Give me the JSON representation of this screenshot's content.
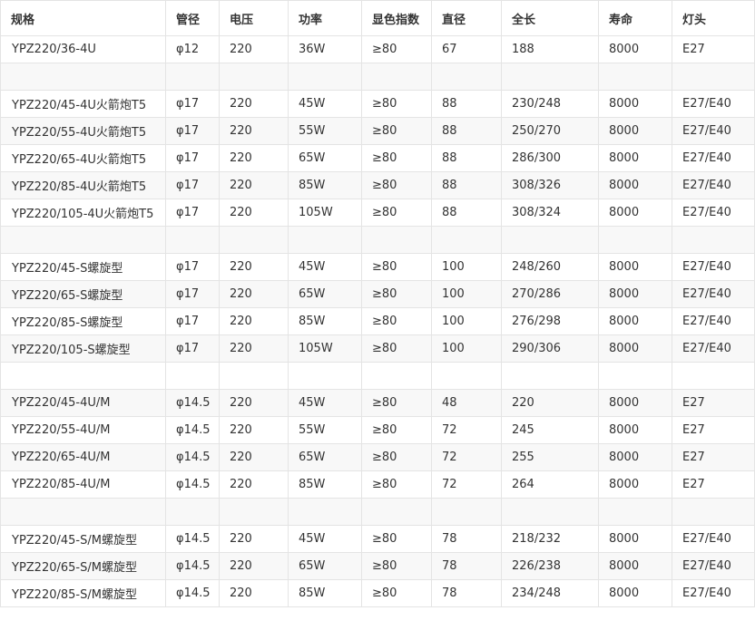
{
  "columns": [
    "规格",
    "管径",
    "电压",
    "功率",
    "显色指数",
    "直径",
    "全长",
    "寿命",
    "灯头"
  ],
  "rows": [
    [
      "YPZ220/36-4U",
      "φ12",
      "220",
      "36W",
      "≥80",
      "67",
      "188",
      "8000",
      "E27"
    ],
    [
      "",
      "",
      "",
      "",
      "",
      "",
      "",
      "",
      ""
    ],
    [
      "YPZ220/45-4U火箭炮T5",
      "φ17",
      "220",
      "45W",
      "≥80",
      "88",
      "230/248",
      "8000",
      "E27/E40"
    ],
    [
      "YPZ220/55-4U火箭炮T5",
      "φ17",
      "220",
      "55W",
      "≥80",
      "88",
      "250/270",
      "8000",
      "E27/E40"
    ],
    [
      "YPZ220/65-4U火箭炮T5",
      "φ17",
      "220",
      "65W",
      "≥80",
      "88",
      "286/300",
      "8000",
      "E27/E40"
    ],
    [
      "YPZ220/85-4U火箭炮T5",
      "φ17",
      "220",
      "85W",
      "≥80",
      "88",
      "308/326",
      "8000",
      "E27/E40"
    ],
    [
      "YPZ220/105-4U火箭炮T5",
      "φ17",
      "220",
      "105W",
      "≥80",
      "88",
      "308/324",
      "8000",
      "E27/E40"
    ],
    [
      "",
      "",
      "",
      "",
      "",
      "",
      "",
      "",
      ""
    ],
    [
      "YPZ220/45-S螺旋型",
      "φ17",
      "220",
      "45W",
      "≥80",
      "100",
      "248/260",
      "8000",
      "E27/E40"
    ],
    [
      "YPZ220/65-S螺旋型",
      "φ17",
      "220",
      "65W",
      "≥80",
      "100",
      "270/286",
      "8000",
      "E27/E40"
    ],
    [
      "YPZ220/85-S螺旋型",
      "φ17",
      "220",
      "85W",
      "≥80",
      "100",
      "276/298",
      "8000",
      "E27/E40"
    ],
    [
      "YPZ220/105-S螺旋型",
      "φ17",
      "220",
      "105W",
      "≥80",
      "100",
      "290/306",
      "8000",
      "E27/E40"
    ],
    [
      "",
      "",
      "",
      "",
      "",
      "",
      "",
      "",
      ""
    ],
    [
      "YPZ220/45-4U/M",
      "φ14.5",
      "220",
      "45W",
      "≥80",
      "48",
      "220",
      "8000",
      "E27"
    ],
    [
      "YPZ220/55-4U/M",
      "φ14.5",
      "220",
      "55W",
      "≥80",
      "72",
      "245",
      "8000",
      "E27"
    ],
    [
      "YPZ220/65-4U/M",
      "φ14.5",
      "220",
      "65W",
      "≥80",
      "72",
      "255",
      "8000",
      "E27"
    ],
    [
      "YPZ220/85-4U/M",
      "φ14.5",
      "220",
      "85W",
      "≥80",
      "72",
      "264",
      "8000",
      "E27"
    ],
    [
      "",
      "",
      "",
      "",
      "",
      "",
      "",
      "",
      ""
    ],
    [
      "YPZ220/45-S/M螺旋型",
      "φ14.5",
      "220",
      "45W",
      "≥80",
      "78",
      "218/232",
      "8000",
      "E27/E40"
    ],
    [
      "YPZ220/65-S/M螺旋型",
      "φ14.5",
      "220",
      "65W",
      "≥80",
      "78",
      "226/238",
      "8000",
      "E27/E40"
    ],
    [
      "YPZ220/85-S/M螺旋型",
      "φ14.5",
      "220",
      "85W",
      "≥80",
      "78",
      "234/248",
      "8000",
      "E27/E40"
    ]
  ]
}
